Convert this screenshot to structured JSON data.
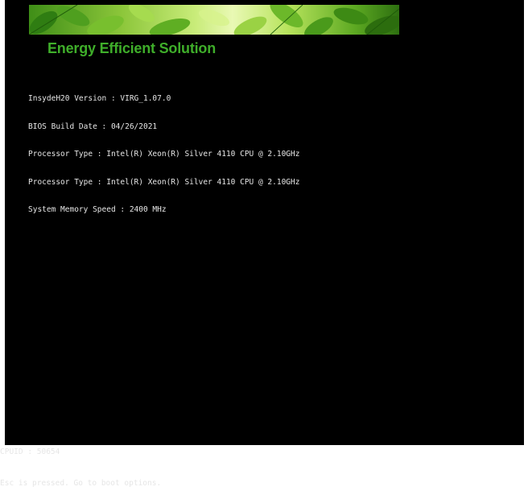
{
  "banner": {
    "icon": "leaves-banner-image",
    "headline": "Energy Efficient Solution",
    "headline_color": "#3fae2a"
  },
  "bios_info": {
    "lines": [
      "InsydeH20 Version : VIRG_1.07.0",
      "BIOS Build Date : 04/26/2021",
      "Processor Type : Intel(R) Xeon(R) Silver 4110 CPU @ 2.10GHz",
      "Processor Type : Intel(R) Xeon(R) Silver 4110 CPU @ 2.10GHz",
      "System Memory Speed : 2400 MHz"
    ]
  },
  "footer": {
    "cpuid": "CPUID : 50654",
    "status": "Esc is pressed. Go to boot options."
  },
  "colors": {
    "background": "#000000",
    "text": "#e6e6e6"
  }
}
